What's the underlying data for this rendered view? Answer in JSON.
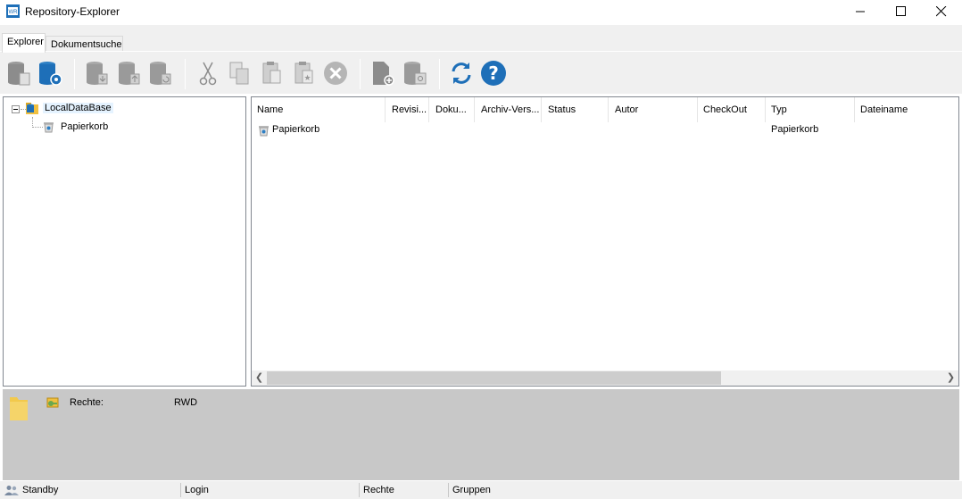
{
  "window": {
    "title": "Repository-Explorer"
  },
  "tabs": [
    {
      "label": "Explorer",
      "active": true
    },
    {
      "label": "Dokumentsuche",
      "active": false
    }
  ],
  "toolbar": {
    "buttons": [
      "db-doc-icon",
      "db-add-icon",
      "db-import-icon",
      "db-export-icon",
      "db-refresh-icon",
      "cut-icon",
      "copy-icon",
      "paste-icon",
      "paste-special-icon",
      "delete-icon",
      "new-doc-icon",
      "db-properties-icon",
      "refresh-icon",
      "help-icon"
    ]
  },
  "tree": {
    "root": {
      "label": "LocalDataBase",
      "icon": "database-folder-icon"
    },
    "children": [
      {
        "label": "Papierkorb",
        "icon": "recycle-bin-icon"
      }
    ]
  },
  "list": {
    "columns": [
      "Name",
      "Revisi...",
      "Doku...",
      "Archiv-Vers...",
      "Status",
      "Autor",
      "CheckOut",
      "Typ",
      "Dateiname"
    ],
    "rows": [
      {
        "name": "Papierkorb",
        "typ": "Papierkorb"
      }
    ]
  },
  "details": {
    "rights_label": "Rechte:",
    "rights_value": "RWD"
  },
  "statusbar": {
    "state": "Standby",
    "login": "Login",
    "rechte": "Rechte",
    "gruppen": "Gruppen"
  },
  "colors": {
    "accent_blue": "#1e6fb8",
    "icon_gray": "#8c8c8c",
    "details_bg": "#c8c8c8"
  }
}
